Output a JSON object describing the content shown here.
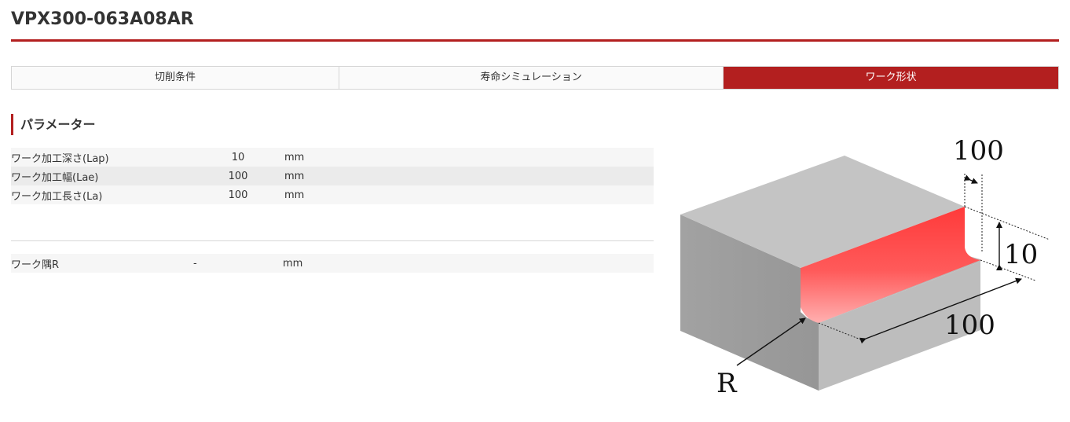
{
  "header": {
    "title": "VPX300-063A08AR"
  },
  "tabs": [
    {
      "label": "切削条件"
    },
    {
      "label": "寿命シミュレーション"
    },
    {
      "label": "ワーク形状"
    }
  ],
  "section": {
    "title": "パラメーター"
  },
  "params": [
    {
      "name": "ワーク加工深さ(Lap)",
      "value": "10",
      "unit": "mm"
    },
    {
      "name": "ワーク加工幅(Lae)",
      "value": "100",
      "unit": "mm"
    },
    {
      "name": "ワーク加工長さ(La)",
      "value": "100",
      "unit": "mm"
    }
  ],
  "corner": {
    "name": "ワーク隅R",
    "value": "-",
    "unit": "mm"
  },
  "diagram": {
    "label_width": "100",
    "label_depth": "10",
    "label_length": "100",
    "label_radius": "R"
  },
  "colors": {
    "accent": "#b31f1f",
    "cut_face": "#ff4a4a"
  }
}
